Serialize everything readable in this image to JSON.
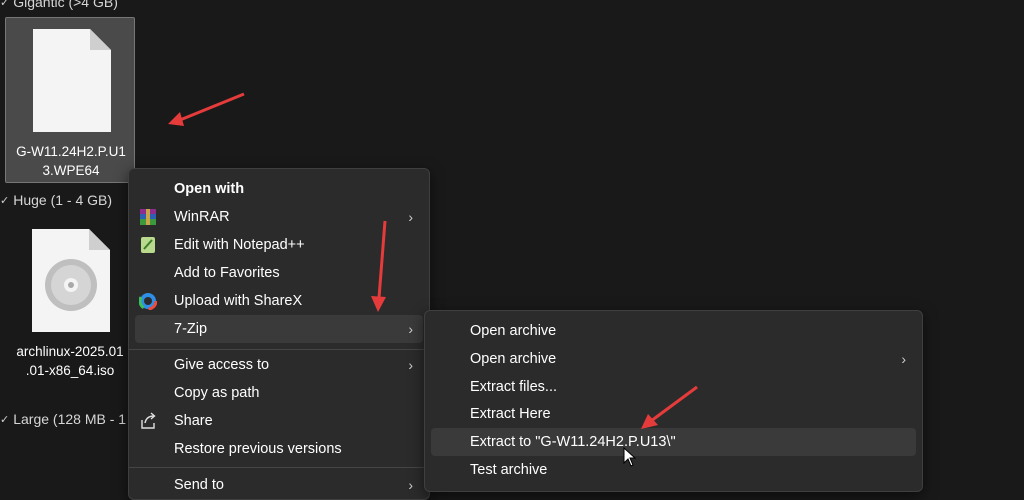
{
  "groups": {
    "gigantic": "Gigantic (>4 GB)",
    "huge": "Huge (1 - 4 GB)",
    "large": "Large (128 MB - 1"
  },
  "files": {
    "wpe": {
      "line1": "G-W11.24H2.P.U1",
      "line2": "3.WPE64"
    },
    "iso": {
      "line1": "archlinux-2025.01",
      "line2": ".01-x86_64.iso"
    }
  },
  "context_menu": {
    "open_with": "Open with",
    "winrar": "WinRAR",
    "notepad": "Edit with Notepad++",
    "favorites": "Add to Favorites",
    "sharex": "Upload with ShareX",
    "sevenzip": "7-Zip",
    "give_access": "Give access to",
    "copy_path": "Copy as path",
    "share": "Share",
    "restore": "Restore previous versions",
    "send_to": "Send to"
  },
  "submenu": {
    "open_archive": "Open archive",
    "open_archive_2": "Open archive",
    "extract_files": "Extract files...",
    "extract_here": "Extract Here",
    "extract_to": "Extract to \"G-W11.24H2.P.U13\\\"",
    "test_archive": "Test archive"
  },
  "colors": {
    "background": "#191919",
    "menu_bg": "#2b2b2b",
    "hover": "#3a3a3a",
    "annotation_arrow": "#e63b3b"
  }
}
